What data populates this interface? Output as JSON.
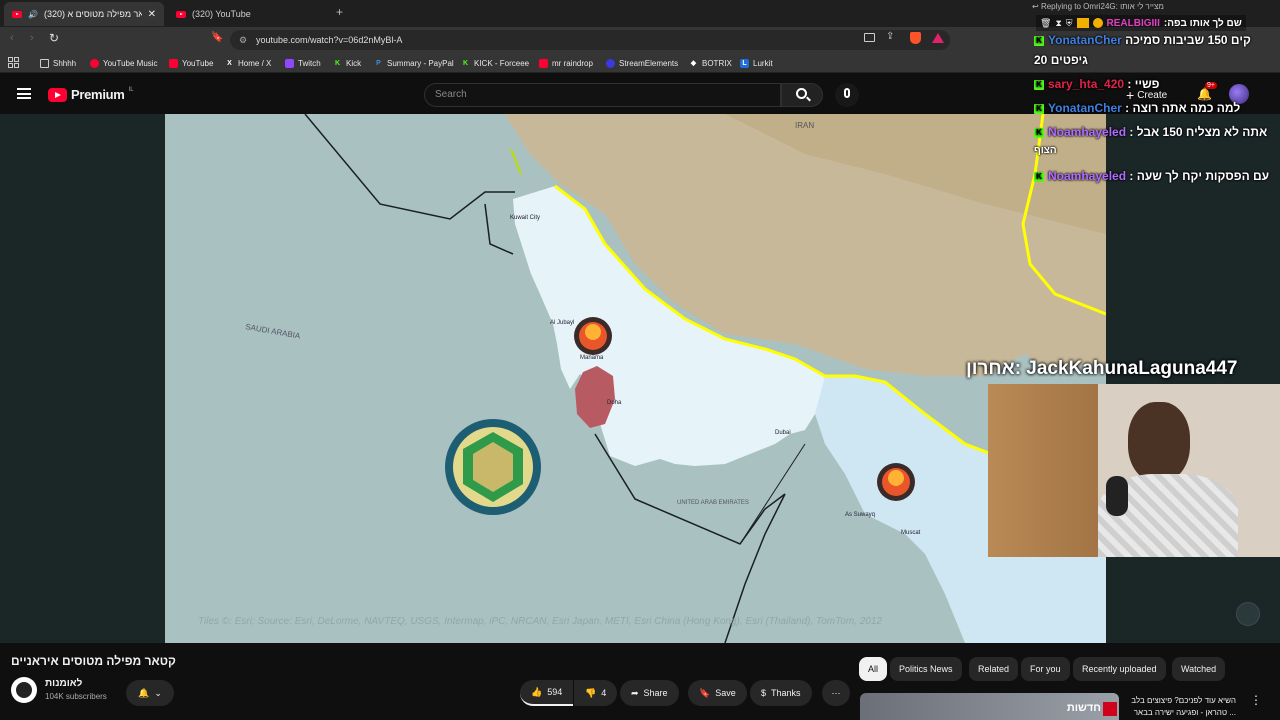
{
  "browser": {
    "tabs": [
      {
        "label": "(320) קטאר מפילה מטוסים א"
      },
      {
        "label": "(320) YouTube"
      }
    ],
    "url": "youtube.com/watch?v=06d2nMyBl-A",
    "bookmarks": [
      {
        "label": "Shhhh"
      },
      {
        "label": "YouTube Music"
      },
      {
        "label": "YouTube"
      },
      {
        "label": "Home / X"
      },
      {
        "label": "Twitch"
      },
      {
        "label": "Kick"
      },
      {
        "label": "Summary - PayPal"
      },
      {
        "label": "KICK - Forceee"
      },
      {
        "label": "mr raindrop"
      },
      {
        "label": "StreamElements"
      },
      {
        "label": "BOTRIX"
      },
      {
        "label": "Lurkit"
      }
    ]
  },
  "masthead": {
    "logo_text": "Premium",
    "logo_sup": "IL",
    "search_placeholder": "Search",
    "create_label": "Create",
    "notif_count": "9+"
  },
  "map": {
    "labels": {
      "iran": "IRAN",
      "saudi": "SAUDI ARABIA",
      "uae": "UNITED ARAB EMIRATES",
      "kuwait": "Kuwait City",
      "manama": "Manama",
      "doha": "Doha",
      "muscat": "Muscat",
      "aljubayl": "Al Jubayl",
      "dubai": "Dubai",
      "sohar": "As Suwayq"
    },
    "attribution": "Tiles ©: Esri; Source: Esri, DeLorme, NAVTEQ, USGS, Intermap, iPC, NRCAN, Esri Japan, METI, Esri China (Hong Kong), Esri (Thailand), TomTom, 2012"
  },
  "overlay": {
    "reply_line": "Replying to Omri24G: מצייר לי אותו",
    "top_user": "REALBIGIII",
    "top_msg": ":שם לך אותו בפה",
    "chat": [
      {
        "user": "YonatanCher",
        "msg": "קים 150 שביבות סמיכה",
        "color": "#3f7fe0"
      },
      {
        "user": "",
        "msg": "20 גיפטים",
        "color": "#ffffff"
      },
      {
        "user": "sary_hta_420",
        "msg": ": פשיי",
        "color": "#e0224a"
      },
      {
        "user": "YonatanCher",
        "msg": ": למה כמה אתה רוצה",
        "color": "#3f7fe0"
      },
      {
        "user": "Noamhayeled",
        "msg": ": אתה לא מצליח 150 אבל",
        "color": "#b06bff"
      },
      {
        "user": "",
        "msg": "הצוף",
        "color": "#ffffff"
      },
      {
        "user": "Noamhayeled",
        "msg": ": עם הפסקות יקח לך שעה",
        "color": "#b06bff"
      }
    ],
    "last_label": "אחרון: JackKahunaLaguna447"
  },
  "video": {
    "title": "קטאר מפילה מטוסים איראניים",
    "channel_name": "לאומנות",
    "subscribers": "104K subscribers",
    "likes": "594",
    "dislikes": "4",
    "share_label": "Share",
    "save_label": "Save",
    "thanks_label": "Thanks"
  },
  "chips": [
    {
      "label": "All"
    },
    {
      "label": "Politics News"
    },
    {
      "label": "Related"
    },
    {
      "label": "For you"
    },
    {
      "label": "Recently uploaded"
    },
    {
      "label": "Watched"
    }
  ],
  "recommendation": {
    "title_line1": "השיא עוד לפניכם? פיצוצים בלב",
    "title_line2": "טהראן - ופגיעה ישירה בבאר ...",
    "thumb_text": "חדשות"
  },
  "colors": {
    "yt_red": "#ff0033",
    "kick_green": "#53fc18",
    "highlight_yellow": "#ffff00"
  }
}
